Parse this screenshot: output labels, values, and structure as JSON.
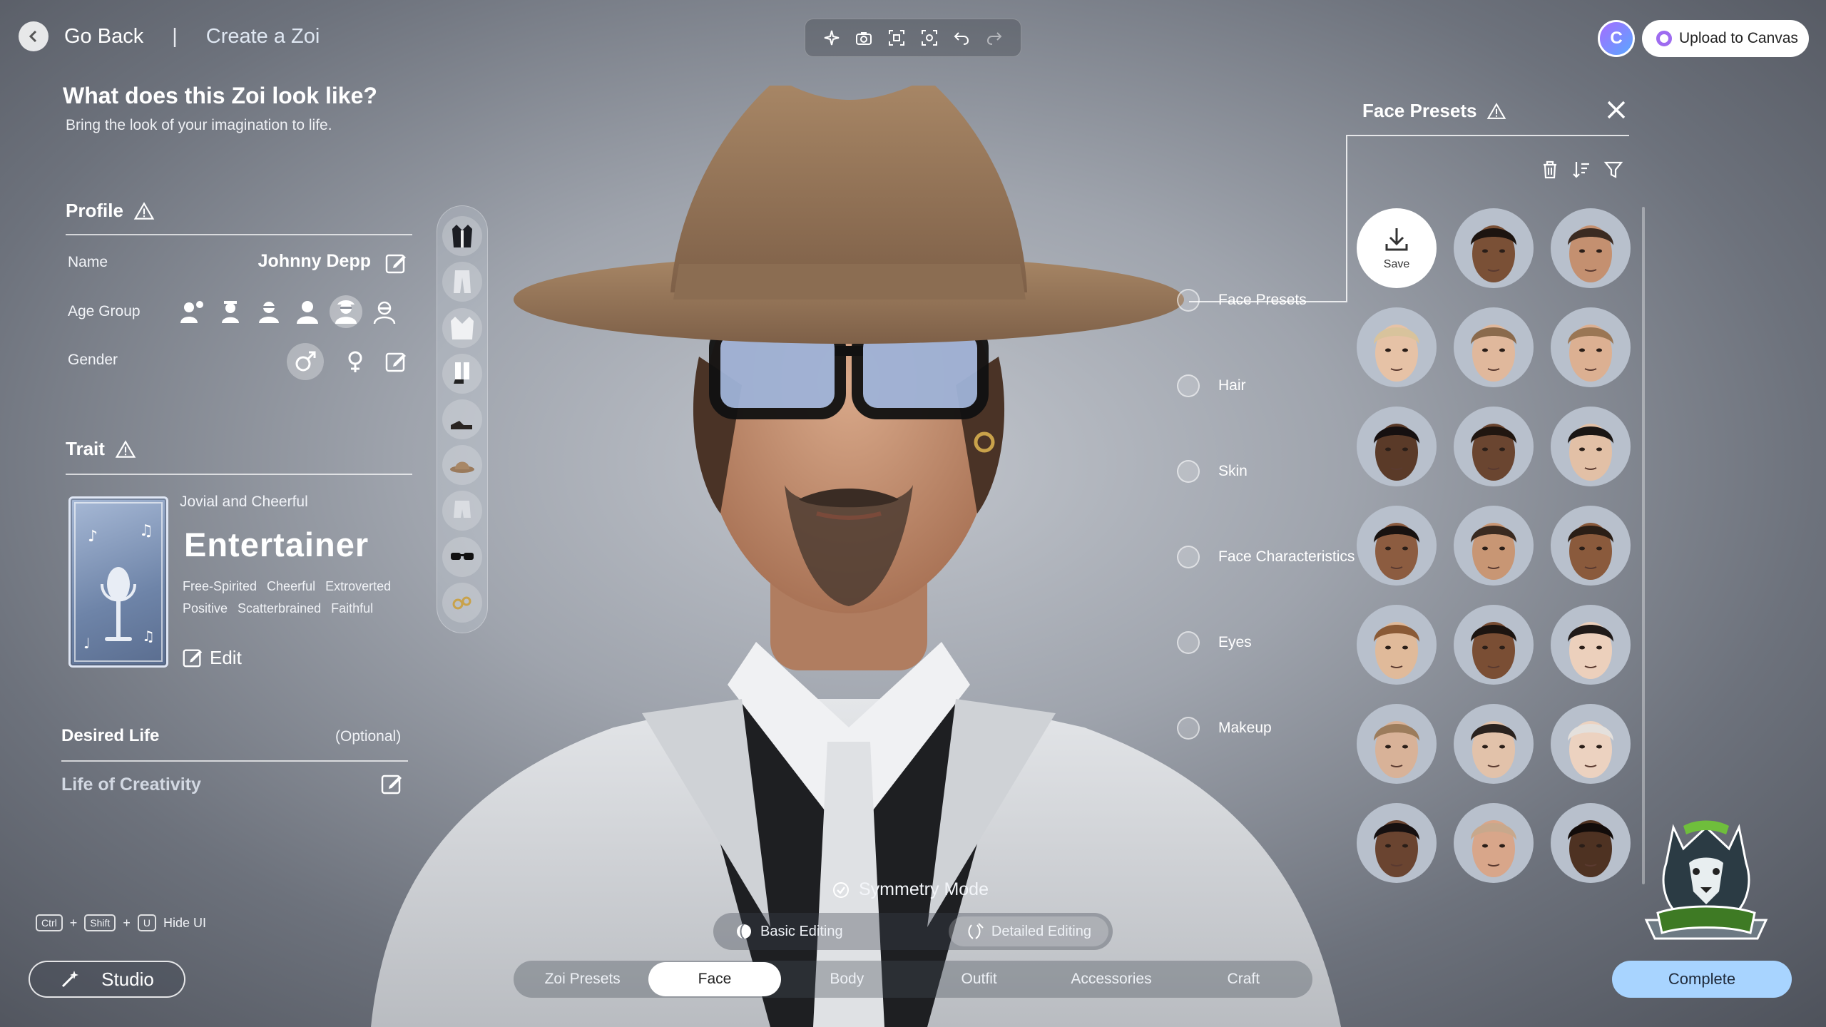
{
  "topbar": {
    "back_label": "Go Back",
    "separator": "|",
    "title": "Create a Zoi",
    "toolbar_icons": [
      "sparkle-icon",
      "camera-icon",
      "frame-icon",
      "focus-icon",
      "undo-icon",
      "redo-icon"
    ],
    "account_initial": "C",
    "upload_label": "Upload to Canvas"
  },
  "header": {
    "title": "What does this Zoi look like?",
    "subtitle": "Bring the look of your imagination to life."
  },
  "profile": {
    "title": "Profile",
    "name_label": "Name",
    "name_value": "Johnny Depp",
    "age_label": "Age Group",
    "age_icons": [
      "infant-icon",
      "child-icon",
      "teen-icon",
      "young-adult-icon",
      "adult-icon",
      "elder-icon"
    ],
    "age_selected": 4,
    "gender_label": "Gender",
    "gender_selected": "male"
  },
  "trait": {
    "title": "Trait",
    "subtitle": "Jovial and Cheerful",
    "name": "Entertainer",
    "tags": [
      "Free-Spirited",
      "Cheerful",
      "Extroverted",
      "Positive",
      "Scatterbrained",
      "Faithful"
    ],
    "edit_label": "Edit"
  },
  "desired_life": {
    "title": "Desired Life",
    "optional": "(Optional)",
    "value": "Life of Creativity"
  },
  "hint": {
    "keys": [
      "Ctrl",
      "Shift",
      "U"
    ],
    "plus": "+",
    "label": "Hide UI"
  },
  "studio_label": "Studio",
  "categories": [
    "Face Presets",
    "Hair",
    "Skin",
    "Face Characteristics",
    "Eyes",
    "Makeup"
  ],
  "face_presets": {
    "title": "Face Presets",
    "save_label": "Save",
    "tools": [
      "trash-icon",
      "sort-icon",
      "filter-icon"
    ],
    "faces": [
      {
        "skin": "#7a5036",
        "hair": "#1c1410"
      },
      {
        "skin": "#c49070",
        "hair": "#3b2b22"
      },
      {
        "skin": "#e6c2a6",
        "hair": "#d8c39c"
      },
      {
        "skin": "#e0b89c",
        "hair": "#8a6a4c"
      },
      {
        "skin": "#dcb092",
        "hair": "#9a7654"
      },
      {
        "skin": "#5a3a28",
        "hair": "#161010"
      },
      {
        "skin": "#6a4530",
        "hair": "#201610"
      },
      {
        "skin": "#e2c0a6",
        "hair": "#1a1614"
      },
      {
        "skin": "#8c5c40",
        "hair": "#181210"
      },
      {
        "skin": "#c89674",
        "hair": "#3a2a20"
      },
      {
        "skin": "#8a5a3c",
        "hair": "#2a1e16"
      },
      {
        "skin": "#e0ba9a",
        "hair": "#8a5a36"
      },
      {
        "skin": "#7a4e34",
        "hair": "#1c1410"
      },
      {
        "skin": "#ecd0bc",
        "hair": "#201a18"
      },
      {
        "skin": "#d8b298",
        "hair": "#9c7c5c"
      },
      {
        "skin": "#e2c2aa",
        "hair": "#2a221e"
      },
      {
        "skin": "#ecd2c0",
        "hair": "#e4e0dc"
      },
      {
        "skin": "#6a4430",
        "hair": "#161010"
      },
      {
        "skin": "#d8a68a",
        "hair": "#c8a88c"
      },
      {
        "skin": "#4e3222",
        "hair": "#120c0a"
      }
    ]
  },
  "symmetry_label": "Symmetry Mode",
  "editing": {
    "options": [
      "Basic Editing",
      "Detailed Editing"
    ],
    "selected": 1
  },
  "tabs": {
    "items": [
      "Zoi Presets",
      "Face",
      "Body",
      "Outfit",
      "Accessories",
      "Craft"
    ],
    "active": 1
  },
  "complete_label": "Complete",
  "colors": {
    "accent": "#a8d4ff",
    "hat": "#9a7a5c",
    "suit": "#d8dadd",
    "upload_ring": "#9e6cf0"
  }
}
